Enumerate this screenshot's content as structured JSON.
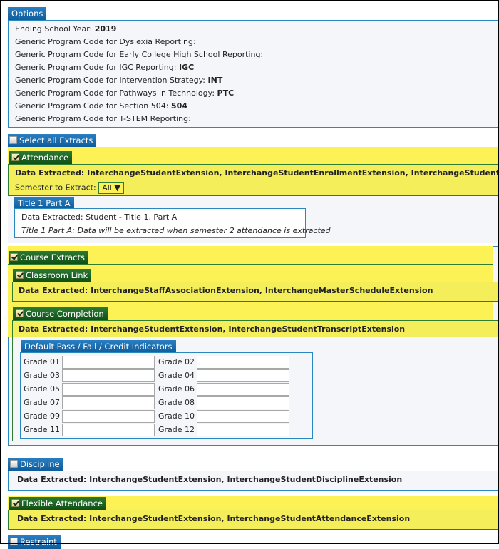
{
  "options": {
    "header": "Options",
    "rows": [
      {
        "label": "Ending School Year:",
        "value": "2019"
      },
      {
        "label": "Generic Program Code for Dyslexia Reporting:",
        "value": ""
      },
      {
        "label": "Generic Program Code for Early College High School Reporting:",
        "value": ""
      },
      {
        "label": "Generic Program Code for IGC Reporting:",
        "value": "IGC"
      },
      {
        "label": "Generic Program Code for Intervention Strategy:",
        "value": "INT"
      },
      {
        "label": "Generic Program Code for Pathways in Technology:",
        "value": "PTC"
      },
      {
        "label": "Generic Program Code for Section 504:",
        "value": "504"
      },
      {
        "label": "Generic Program Code for T-STEM Reporting:",
        "value": ""
      }
    ]
  },
  "select_all": {
    "label": "Select all Extracts",
    "checked": false
  },
  "attendance": {
    "label": "Attendance",
    "checked": true,
    "data_extracted": "Data Extracted: InterchangeStudentExtension, InterchangeStudentEnrollmentExtension, InterchangeStudentAttendanceExtension",
    "semester_label": "Semester to Extract:",
    "semester_value": "All",
    "semester_arrow": "▼",
    "title1": {
      "header": "Title 1 Part A",
      "data_extracted": "Data Extracted: Student - Title 1, Part A",
      "note": "Title 1 Part A: Data will be extracted when semester 2 attendance is extracted"
    }
  },
  "course_extracts": {
    "label": "Course Extracts",
    "checked": true,
    "classroom_link": {
      "label": "Classroom Link",
      "checked": true,
      "data_extracted": "Data Extracted: InterchangeStaffAssociationExtension, InterchangeMasterScheduleExtension"
    },
    "course_completion": {
      "label": "Course Completion",
      "checked": true,
      "data_extracted": "Data Extracted: InterchangeStudentExtension, InterchangeStudentTranscriptExtension"
    },
    "indicators": {
      "header": "Default Pass / Fail / Credit Indicators",
      "grades": [
        {
          "label": "Grade 01",
          "value": ""
        },
        {
          "label": "Grade 02",
          "value": ""
        },
        {
          "label": "Grade 03",
          "value": ""
        },
        {
          "label": "Grade 04",
          "value": ""
        },
        {
          "label": "Grade 05",
          "value": ""
        },
        {
          "label": "Grade 06",
          "value": ""
        },
        {
          "label": "Grade 07",
          "value": ""
        },
        {
          "label": "Grade 08",
          "value": ""
        },
        {
          "label": "Grade 09",
          "value": ""
        },
        {
          "label": "Grade 10",
          "value": ""
        },
        {
          "label": "Grade 11",
          "value": ""
        },
        {
          "label": "Grade 12",
          "value": ""
        }
      ]
    }
  },
  "discipline": {
    "label": "Discipline",
    "checked": false,
    "data_extracted": "Data Extracted: InterchangeStudentExtension, InterchangeStudentDisciplineExtension"
  },
  "flexible_attendance": {
    "label": "Flexible Attendance",
    "checked": true,
    "data_extracted": "Data Extracted: InterchangeStudentExtension, InterchangeStudentAttendanceExtension"
  },
  "restraint": {
    "label": "Restraint",
    "checked": false
  },
  "colors": {
    "blue_header": "#0d5a9a",
    "green_header": "#0f4d16",
    "selected_yellow": "#fdf255",
    "panel_border_blue": "#2a88c0",
    "panel_bg": "#f5f6fa"
  }
}
